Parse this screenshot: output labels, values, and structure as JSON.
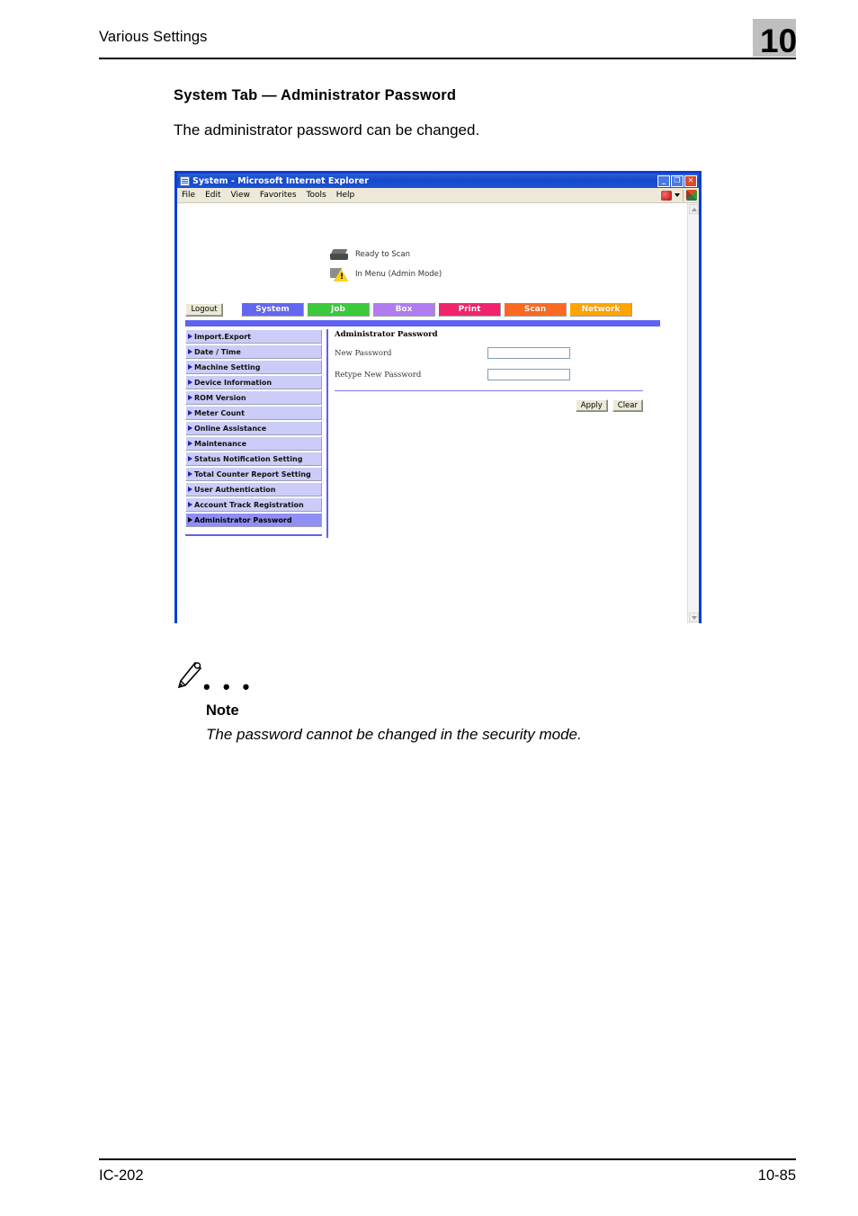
{
  "header": {
    "running_title": "Various Settings",
    "chapter_number": "10",
    "chapter_badge_color": "#bfbfbf"
  },
  "section": {
    "title": "System Tab — Administrator Password",
    "intro": "The administrator password can be changed."
  },
  "browser": {
    "title_bar": {
      "title": "System - Microsoft Internet Explorer",
      "icon": "ie-page-icon",
      "minimize_label": "_",
      "maximize_label": "❐",
      "close_label": "✕",
      "title_bar_color": "#1549c8",
      "close_color": "#e04a2a"
    },
    "menu_bar": {
      "items": [
        "File",
        "Edit",
        "View",
        "Favorites",
        "Tools",
        "Help"
      ],
      "right_icons": [
        "messenger-icon",
        "chevron-down-icon",
        "windows-flag-icon"
      ]
    },
    "status": {
      "rows": [
        {
          "icon": "printer-icon",
          "text": "Ready to Scan"
        },
        {
          "icon": "warning-icon",
          "text": "In Menu (Admin Mode)"
        }
      ]
    },
    "nav": {
      "logout_label": "Logout",
      "tabs": [
        {
          "label": "System",
          "color": "#6366f1",
          "active": true
        },
        {
          "label": "Job",
          "color": "#3cc93c",
          "active": false
        },
        {
          "label": "Box",
          "color": "#b07cf0",
          "active": false
        },
        {
          "label": "Print",
          "color": "#f0246e",
          "active": false
        },
        {
          "label": "Scan",
          "color": "#fa6a22",
          "active": false
        },
        {
          "label": "Network",
          "color": "#ffa400",
          "active": false
        }
      ],
      "underbar_color": "#5f62f0"
    },
    "sidebar": {
      "items": [
        {
          "label": "Import.Export",
          "active": false
        },
        {
          "label": "Date / Time",
          "active": false
        },
        {
          "label": "Machine Setting",
          "active": false
        },
        {
          "label": "Device Information",
          "active": false
        },
        {
          "label": "ROM Version",
          "active": false
        },
        {
          "label": "Meter Count",
          "active": false
        },
        {
          "label": "Online Assistance",
          "active": false
        },
        {
          "label": "Maintenance",
          "active": false
        },
        {
          "label": "Status Notification Setting",
          "active": false
        },
        {
          "label": "Total Counter Report Setting",
          "active": false
        },
        {
          "label": "User Authentication",
          "active": false
        },
        {
          "label": "Account Track Registration",
          "active": false
        },
        {
          "label": "Administrator Password",
          "active": true
        }
      ],
      "item_color": "#ccccf8",
      "active_color": "#8f8ff4"
    },
    "form": {
      "title": "Administrator Password",
      "fields": [
        {
          "label": "New Password",
          "value": "",
          "placeholder": ""
        },
        {
          "label": "Retype New Password",
          "value": "",
          "placeholder": ""
        }
      ],
      "buttons": [
        {
          "label": "Apply"
        },
        {
          "label": "Clear"
        }
      ]
    },
    "scrollbar": {
      "up_arrow": "scroll-up-arrow",
      "down_arrow": "scroll-down-arrow"
    }
  },
  "note": {
    "icon": "pencil-icon",
    "dots": "• • •",
    "label": "Note",
    "text": "The password cannot be changed in the security mode."
  },
  "footer": {
    "left": "IC-202",
    "right": "10-85"
  }
}
